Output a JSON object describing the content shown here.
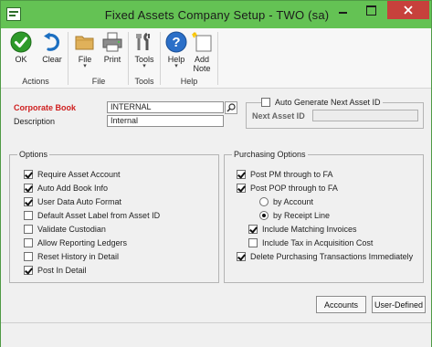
{
  "window": {
    "title": "Fixed Assets Company Setup  -  TWO (sa)",
    "controls": [
      "minimize",
      "maximize",
      "close"
    ]
  },
  "toolbar": {
    "groups": [
      {
        "label": "Actions",
        "buttons": [
          {
            "label": "OK",
            "icon": "check-icon"
          },
          {
            "label": "Clear",
            "icon": "undo-icon"
          }
        ]
      },
      {
        "label": "File",
        "buttons": [
          {
            "label": "File",
            "icon": "folder-icon"
          },
          {
            "label": "Print",
            "icon": "printer-icon"
          }
        ]
      },
      {
        "label": "Tools",
        "buttons": [
          {
            "label": "Tools",
            "icon": "tools-icon"
          }
        ]
      },
      {
        "label": "Help",
        "buttons": [
          {
            "label": "Help",
            "icon": "help-icon"
          },
          {
            "label": "Add Note",
            "icon": "add-note-icon"
          }
        ]
      }
    ]
  },
  "form": {
    "corporate_book_label": "Corporate Book",
    "corporate_book_value": "INTERNAL",
    "description_label": "Description",
    "description_value": "Internal",
    "auto_generate_label": "Auto Generate Next Asset ID",
    "next_asset_id_label": "Next Asset ID",
    "next_asset_id_value": ""
  },
  "options": {
    "title": "Options",
    "items": [
      {
        "label": "Require Asset Account",
        "checked": true
      },
      {
        "label": "Auto Add Book Info",
        "checked": true
      },
      {
        "label": "User Data Auto Format",
        "checked": true
      },
      {
        "label": "Default Asset Label from Asset ID",
        "checked": false
      },
      {
        "label": "Validate Custodian",
        "checked": false
      },
      {
        "label": "Allow Reporting Ledgers",
        "checked": false
      },
      {
        "label": "Reset History in Detail",
        "checked": false
      },
      {
        "label": "Post In Detail",
        "checked": true
      }
    ]
  },
  "purchasing": {
    "title": "Purchasing Options",
    "post_pm": {
      "label": "Post PM through to FA",
      "checked": true
    },
    "post_pop": {
      "label": "Post POP through to FA",
      "checked": true
    },
    "by_account": {
      "label": "by Account",
      "selected": false
    },
    "by_receipt_line": {
      "label": "by Receipt Line",
      "selected": true
    },
    "include_matching": {
      "label": "Include Matching Invoices",
      "checked": true
    },
    "include_tax": {
      "label": "Include Tax in Acquisition Cost",
      "checked": false
    },
    "delete_purchasing": {
      "label": "Delete Purchasing Transactions Immediately",
      "checked": true
    }
  },
  "buttons": {
    "accounts": "Accounts",
    "user_defined": "User-Defined"
  },
  "colors": {
    "titlebar": "#64c254",
    "required_label": "#cf1f1f",
    "close_button": "#c7413c"
  }
}
